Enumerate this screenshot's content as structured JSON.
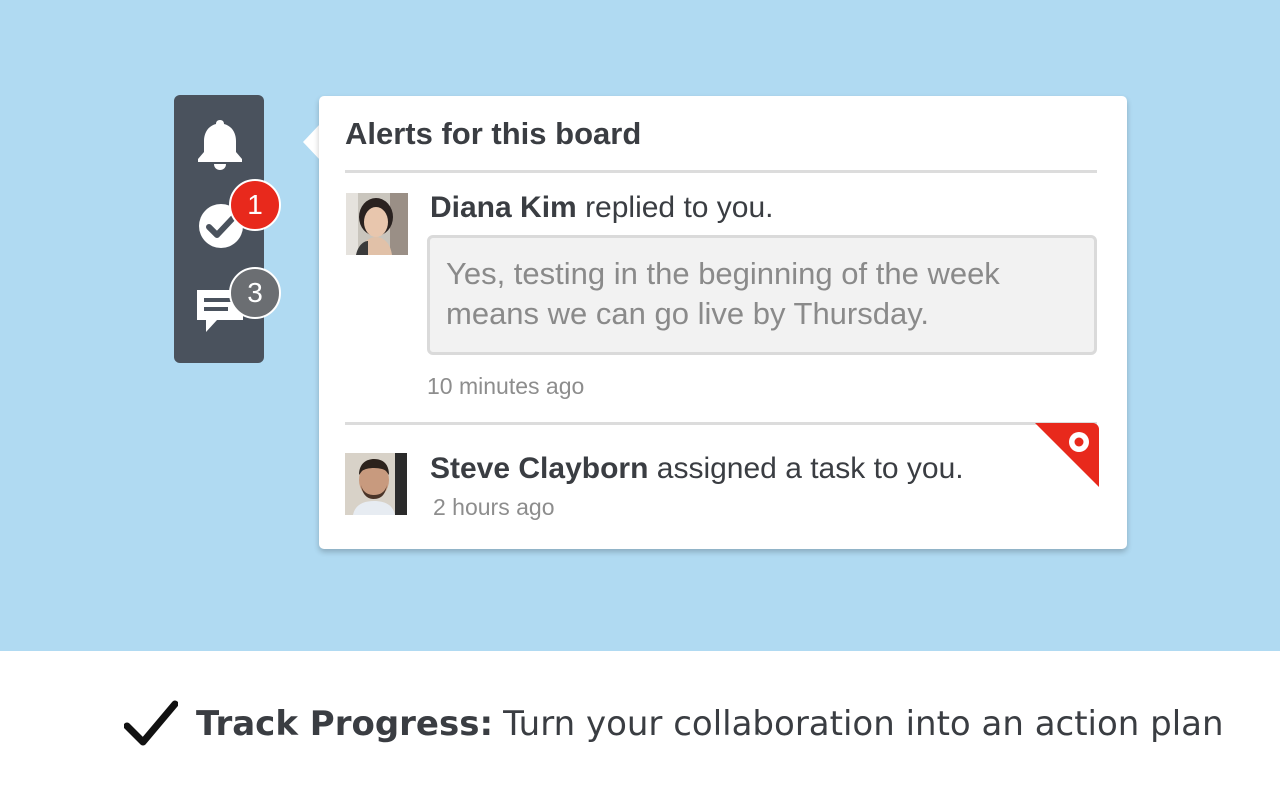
{
  "toolbar": {
    "items": [
      {
        "name": "alerts",
        "icon": "bell-icon"
      },
      {
        "name": "tasks",
        "icon": "check-circle-icon",
        "badge": "1",
        "badge_color": "#e8291c"
      },
      {
        "name": "comments",
        "icon": "speech-bubble-icon",
        "badge": "3",
        "badge_color": "#6b6e72"
      }
    ]
  },
  "panel": {
    "title": "Alerts for this board",
    "alerts": [
      {
        "name": "Diana Kim",
        "action": "replied to you.",
        "quote": "Yes, testing in the beginning of the week means we can go live by Thursday.",
        "time": "10 minutes ago"
      },
      {
        "name": "Steve Clayborn",
        "action": "assigned a task to you.",
        "time": "2 hours ago",
        "flag_color": "#e8291c"
      }
    ]
  },
  "caption": {
    "title": "Track Progress:",
    "text": "Turn your collaboration into an action plan"
  },
  "colors": {
    "background": "#b0daf2",
    "toolbar": "#4a525d",
    "accent_red": "#e8291c"
  }
}
